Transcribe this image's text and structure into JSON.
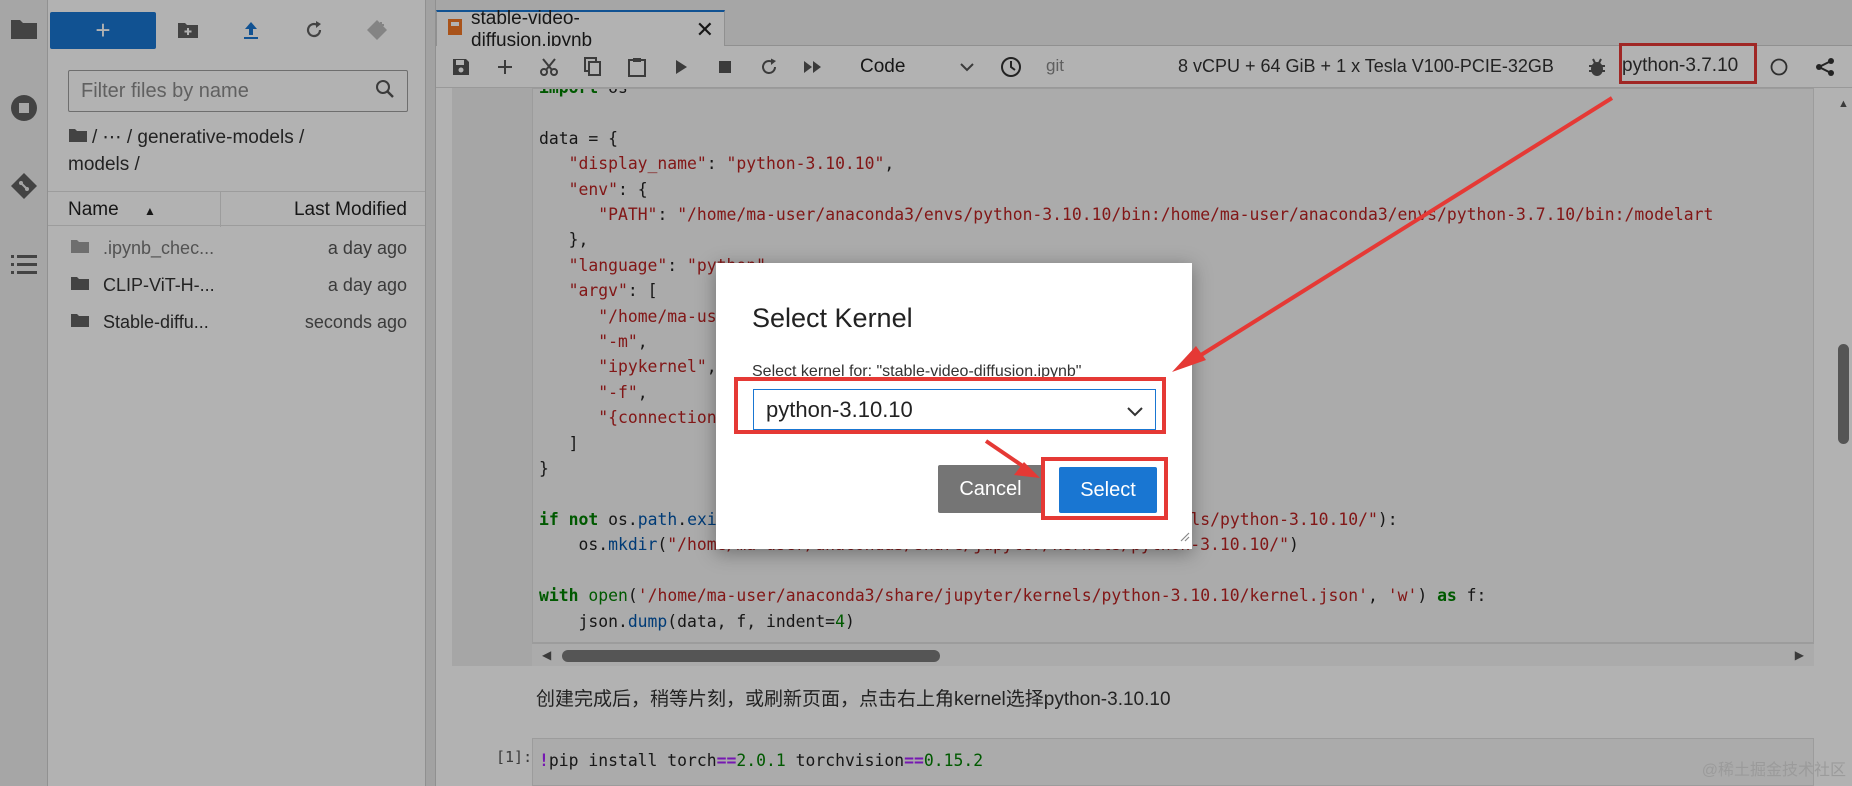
{
  "sidebar": {
    "icons": [
      "folder-icon",
      "running-stop-icon",
      "git-icon",
      "table-of-contents-icon"
    ]
  },
  "file_browser": {
    "new_button_label": "+",
    "filter_placeholder": "Filter files by name",
    "breadcrumb": "/   ⋯   / generative-models / models /",
    "columns": {
      "name": "Name",
      "last_modified": "Last Modified"
    },
    "files": [
      {
        "name": ".ipynb_chec...",
        "modified": "a day ago"
      },
      {
        "name": "CLIP-ViT-H-...",
        "modified": "a day ago"
      },
      {
        "name": "Stable-diffu...",
        "modified": "seconds ago"
      }
    ]
  },
  "tab": {
    "title": "stable-video-diffusion.ipynb",
    "close": "✕"
  },
  "toolbar": {
    "cell_type": "Code",
    "git": "git",
    "resources": "8 vCPU + 64 GiB + 1 x Tesla V100-PCIE-32GB",
    "kernel": "python-3.7.10"
  },
  "cells": {
    "markdown": "创建完成后，稍等片刻，或刷新页面，点击右上角kernel选择python-3.10.10",
    "cell2_prompt": "[1]:"
  },
  "dialog": {
    "title": "Select Kernel",
    "subtitle": "Select kernel for: \"stable-video-diffusion.ipynb\"",
    "selected_kernel": "python-3.10.10",
    "cancel_label": "Cancel",
    "select_label": "Select"
  },
  "colors": {
    "accent": "#1976d2",
    "annotation": "#e53935"
  },
  "watermark": "@稀土掘金技术社区"
}
